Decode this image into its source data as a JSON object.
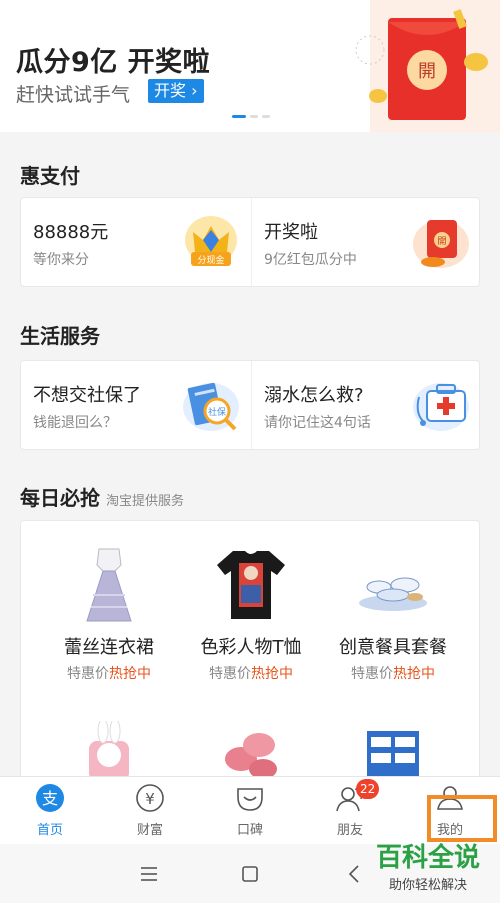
{
  "banner": {
    "title": "瓜分9亿 开奖啦",
    "subtitle": "赶快试试手气",
    "button": "开奖",
    "button_arrow": "›",
    "envelope_char": "開"
  },
  "hui_pay": {
    "title": "惠支付",
    "left": {
      "title": "88888元",
      "subtitle": "等你来分",
      "icon_text": "分现金"
    },
    "right": {
      "title": "开奖啦",
      "subtitle": "9亿红包瓜分中",
      "icon_text": "開"
    }
  },
  "life_services": {
    "title": "生活服务",
    "left": {
      "title": "不想交社保了",
      "subtitle": "钱能退回么？",
      "icon_text": "社保"
    },
    "right": {
      "title": "溺水怎么救?",
      "subtitle": "请你记住这4句话"
    }
  },
  "daily_deals": {
    "title": "每日必抢",
    "subtitle": "淘宝提供服务",
    "items": [
      {
        "name": "蕾丝连衣裙",
        "tag_prefix": "特惠价",
        "tag_hot": "热抢中"
      },
      {
        "name": "色彩人物T恤",
        "tag_prefix": "特惠价",
        "tag_hot": "热抢中"
      },
      {
        "name": "创意餐具套餐",
        "tag_prefix": "特惠价",
        "tag_hot": "热抢中"
      }
    ]
  },
  "tabbar": {
    "tabs": [
      {
        "label": "首页",
        "icon": "alipay-icon"
      },
      {
        "label": "财富",
        "icon": "yen-icon"
      },
      {
        "label": "口碑",
        "icon": "koubei-icon"
      },
      {
        "label": "朋友",
        "icon": "friends-icon",
        "badge": "22"
      },
      {
        "label": "我的",
        "icon": "profile-icon"
      }
    ],
    "yen_symbol": "¥",
    "alipay_char": "支"
  },
  "watermark": {
    "main": "百科全说",
    "sub": "助你轻松解决"
  },
  "colors": {
    "accent": "#1e88e5",
    "hot": "#e8541e",
    "badge": "#f0412b",
    "highlight": "#f28c28"
  }
}
